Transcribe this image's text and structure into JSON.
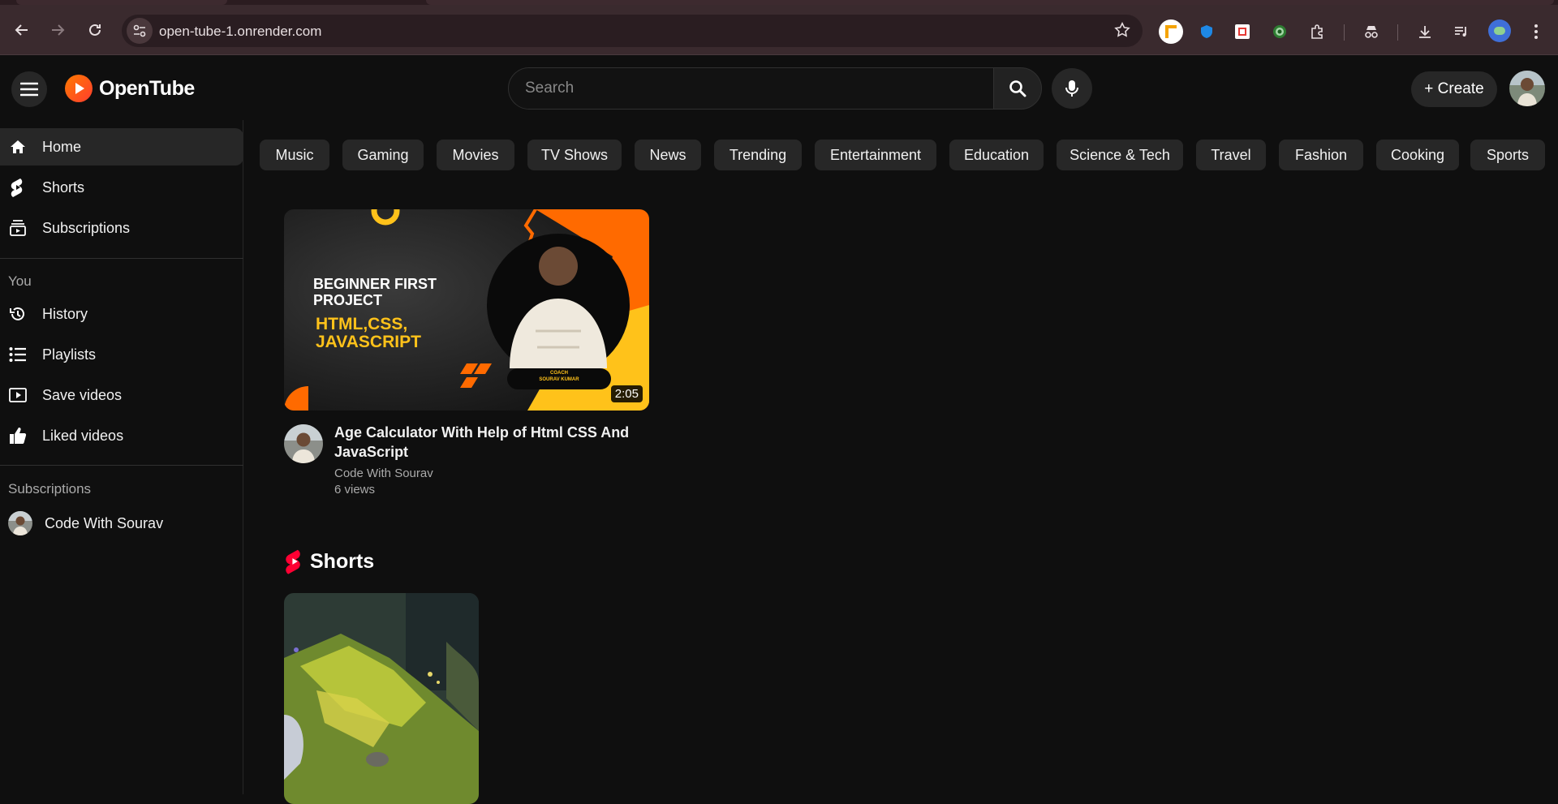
{
  "browser": {
    "url": "open-tube-1.onrender.com"
  },
  "header": {
    "app_name": "OpenTube",
    "search_placeholder": "Search",
    "create_label": "+ Create"
  },
  "sidebar": {
    "main": [
      {
        "label": "Home",
        "icon": "home-icon"
      },
      {
        "label": "Shorts",
        "icon": "shorts-icon"
      },
      {
        "label": "Subscriptions",
        "icon": "subscriptions-icon"
      }
    ],
    "you_heading": "You",
    "you": [
      {
        "label": "History",
        "icon": "history-icon"
      },
      {
        "label": "Playlists",
        "icon": "playlists-icon"
      },
      {
        "label": "Save videos",
        "icon": "save-videos-icon"
      },
      {
        "label": "Liked videos",
        "icon": "thumbs-up-icon"
      }
    ],
    "subs_heading": "Subscriptions",
    "subs": [
      {
        "label": "Code With Sourav"
      }
    ]
  },
  "chips": [
    "Music",
    "Gaming",
    "Movies",
    "TV Shows",
    "News",
    "Trending",
    "Entertainment",
    "Education",
    "Science & Tech",
    "Travel",
    "Fashion",
    "Cooking",
    "Sports"
  ],
  "video": {
    "title": "Age Calculator With Help of Html CSS And JavaScript",
    "channel": "Code With Sourav",
    "views": "6 views",
    "duration": "2:05",
    "thumbnail": {
      "line1": "BEGINNER FIRST",
      "line2": "PROJECT",
      "line3": "HTML,CSS,",
      "line4": "JAVASCRIPT",
      "badge1": "COACH",
      "badge2": "SOURAV KUMAR"
    }
  },
  "shorts": {
    "heading": "Shorts"
  },
  "colors": {
    "brand": "#ff5a1f",
    "accent_yellow": "#ffb300",
    "shorts_red": "#ff0033"
  }
}
